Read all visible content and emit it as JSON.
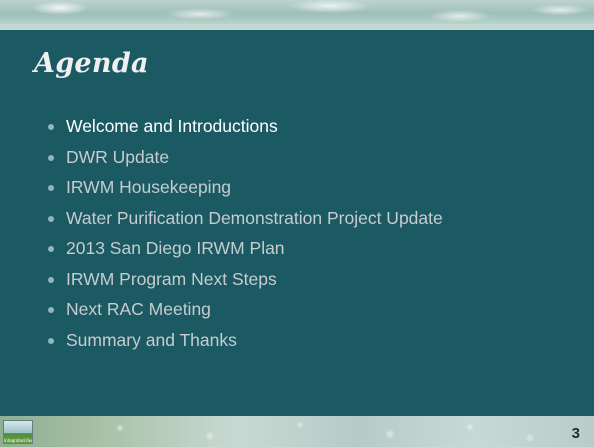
{
  "slide": {
    "title": "Agenda",
    "items": [
      "Welcome and Introductions",
      "DWR Update",
      "IRWM Housekeeping",
      "Water Purification Demonstration Project Update",
      "2013 San Diego IRWM Plan",
      "IRWM Program Next Steps",
      "Next RAC Meeting",
      "Summary and Thanks"
    ],
    "active_item_index": 0,
    "page_number": "3",
    "logo_text": "Integrated Regional"
  },
  "colors": {
    "panel_background": "#1b5a63",
    "title_text": "#f0f0f0",
    "active_item_text": "#ffffff",
    "inactive_item_text": "#c6ccd0",
    "bullet": "#8fb7bd"
  }
}
